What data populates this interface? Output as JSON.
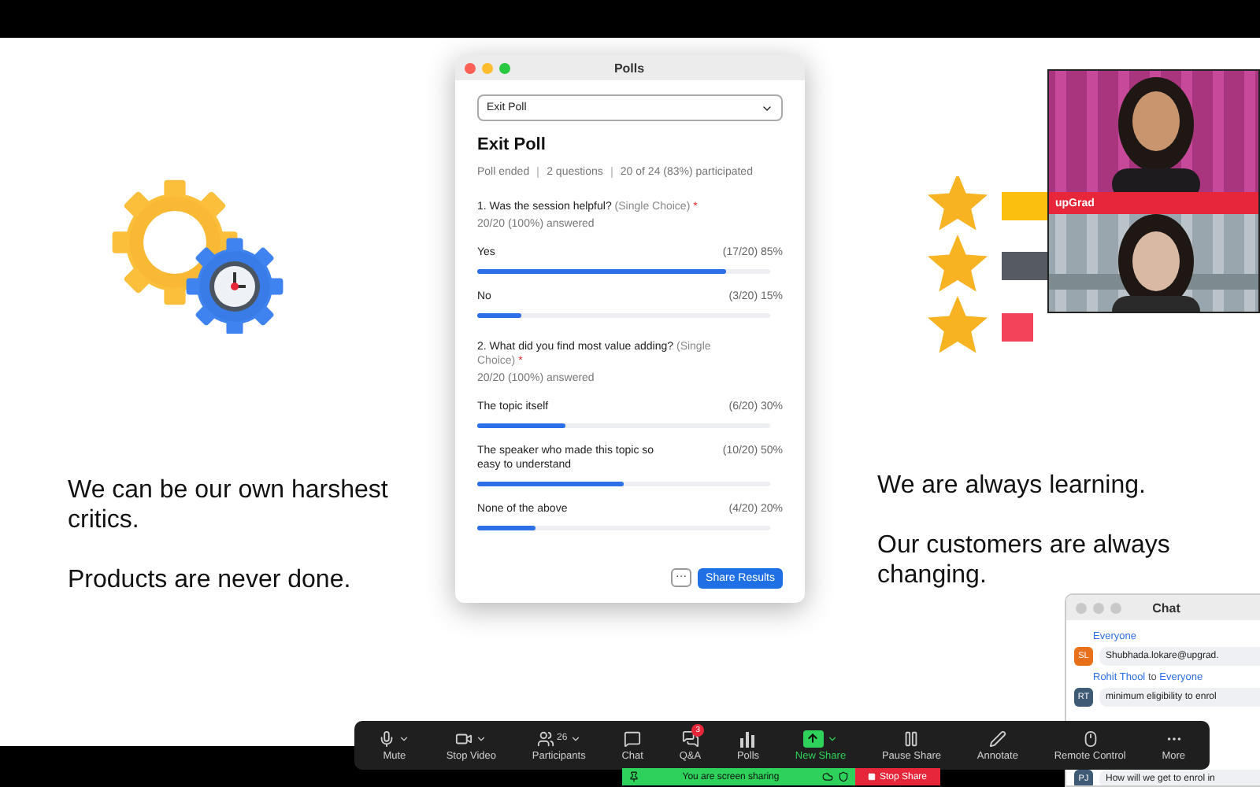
{
  "slide": {
    "left_texts": [
      "We can be our own harshest critics.",
      "Products are never done."
    ],
    "right_texts": [
      "We are always learning.",
      "Our customers are always changing."
    ]
  },
  "polls_window": {
    "title": "Polls",
    "selector": "Exit Poll",
    "heading": "Exit Poll",
    "meta": [
      "Poll ended",
      "2 questions",
      "20 of 24 (83%) participated"
    ],
    "questions": [
      {
        "prompt": "1. Was the session helpful?",
        "type": "(Single Choice)",
        "required": "*",
        "answered": "20/20 (100%) answered",
        "options": [
          {
            "label": "Yes",
            "result": "(17/20) 85%",
            "level": 0.85
          },
          {
            "label": "No",
            "result": "(3/20) 15%",
            "level": 0.15
          }
        ]
      },
      {
        "prompt": "2. What did you find most value adding?",
        "type": "(Single Choice)",
        "required": "*",
        "answered": "20/20 (100%) answered",
        "options": [
          {
            "label": "The topic itself",
            "result": "(6/20) 30%",
            "level": 0.3
          },
          {
            "label": "The speaker who made this topic so easy to understand",
            "result": "(10/20) 50%",
            "level": 0.5
          },
          {
            "label": "None of the above",
            "result": "(4/20) 20%",
            "level": 0.2
          }
        ]
      }
    ],
    "more_button": "···",
    "share_button": "Share Results"
  },
  "video": {
    "banner": "upGrad"
  },
  "chat_window": {
    "title": "Chat",
    "messages": [
      {
        "to": "Everyone",
        "initials": "SL",
        "color": "#e8701a",
        "text": "Shubhada.lokare@upgrad."
      },
      {
        "sender": "Rohit Thool",
        "to_word": "to",
        "to": "Everyone",
        "initials": "RT",
        "color": "#3e5a75",
        "text": "minimum eligibility to enrol"
      },
      {
        "initials": "PJ",
        "color": "#3e5a75",
        "text": "How will we get to enrol in"
      }
    ]
  },
  "toolbar": {
    "items": [
      {
        "kind": "mic",
        "label": "Mute",
        "caret": true,
        "active": false
      },
      {
        "kind": "video",
        "label": "Stop Video",
        "caret": true,
        "active": false
      },
      {
        "kind": "participants",
        "label": "Participants",
        "count": "26",
        "caret": true,
        "active": false
      },
      {
        "kind": "chat",
        "label": "Chat",
        "caret": false,
        "active": false
      },
      {
        "kind": "qa",
        "label": "Q&A",
        "badge": "3",
        "caret": false,
        "active": false
      },
      {
        "kind": "polls",
        "label": "Polls",
        "caret": false,
        "active": false
      },
      {
        "kind": "share",
        "label": "New Share",
        "caret": true,
        "active": true
      },
      {
        "kind": "pause",
        "label": "Pause Share",
        "caret": false,
        "active": false
      },
      {
        "kind": "annotate",
        "label": "Annotate",
        "caret": false,
        "active": false
      },
      {
        "kind": "remote",
        "label": "Remote Control",
        "caret": false,
        "active": false
      },
      {
        "kind": "more",
        "label": "More",
        "caret": false,
        "active": false
      }
    ]
  },
  "share_bar": {
    "status": "You are screen sharing",
    "stop": "Stop Share"
  }
}
